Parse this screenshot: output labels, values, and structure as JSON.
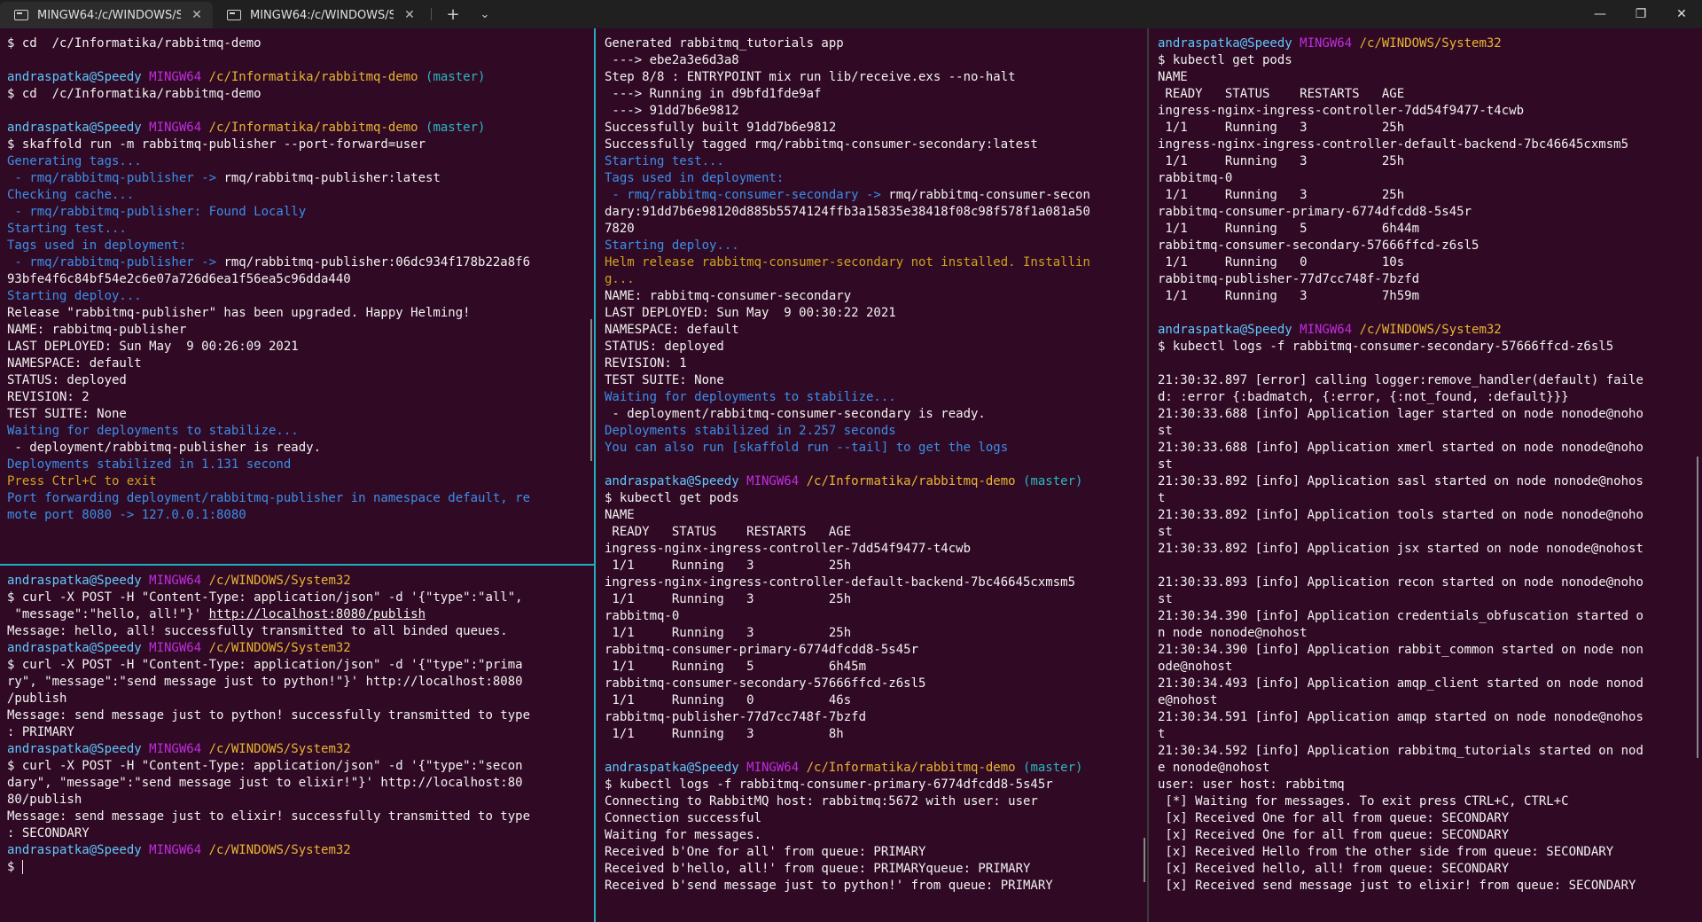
{
  "tabs": [
    {
      "title": "MINGW64:/c/WINDOWS/Syster",
      "close": "✕"
    },
    {
      "title": "MINGW64:/c/WINDOWS/Syster",
      "close": "✕"
    }
  ],
  "toolbar": {
    "new_tab": "+",
    "dropdown": "⌄"
  },
  "window": {
    "minimize": "—",
    "restore": "❐",
    "close": "✕"
  },
  "panes": {
    "top_left": [
      [
        {
          "t": "$ cd  /c/Informatika/rabbitmq-demo",
          "c": "c-white"
        }
      ],
      [],
      [
        {
          "t": "andraspatka@Speedy",
          "c": "prompt-user"
        },
        {
          "t": " MINGW64",
          "c": "prompt-host"
        },
        {
          "t": " /c/Informatika/rabbitmq-demo",
          "c": "prompt-path"
        },
        {
          "t": " (master)",
          "c": "prompt-branch"
        }
      ],
      [
        {
          "t": "$ cd  /c/Informatika/rabbitmq-demo",
          "c": "c-white"
        }
      ],
      [],
      [
        {
          "t": "andraspatka@Speedy",
          "c": "prompt-user"
        },
        {
          "t": " MINGW64",
          "c": "prompt-host"
        },
        {
          "t": " /c/Informatika/rabbitmq-demo",
          "c": "prompt-path"
        },
        {
          "t": " (master)",
          "c": "prompt-branch"
        }
      ],
      [
        {
          "t": "$ skaffold run -m rabbitmq-publisher --port-forward=user",
          "c": "c-white"
        }
      ],
      [
        {
          "t": "Generating tags...",
          "c": "c-blue"
        }
      ],
      [
        {
          "t": " - rmq/rabbitmq-publisher ->",
          "c": "c-blue"
        },
        {
          "t": " rmq/rabbitmq-publisher:latest",
          "c": "c-white"
        }
      ],
      [
        {
          "t": "Checking cache...",
          "c": "c-blue"
        }
      ],
      [
        {
          "t": " - rmq/rabbitmq-publisher: Found Locally",
          "c": "c-blue"
        }
      ],
      [
        {
          "t": "Starting test...",
          "c": "c-blue"
        }
      ],
      [
        {
          "t": "Tags used in deployment:",
          "c": "c-blue"
        }
      ],
      [
        {
          "t": " - rmq/rabbitmq-publisher ->",
          "c": "c-blue"
        },
        {
          "t": " rmq/rabbitmq-publisher:06dc934f178b22a8f6",
          "c": "c-white"
        }
      ],
      [
        {
          "t": "93bfe4f6c84bf54e2c6e07a726d6ea1f56ea5c96dda440",
          "c": "c-white"
        }
      ],
      [
        {
          "t": "Starting deploy...",
          "c": "c-blue"
        }
      ],
      [
        {
          "t": "Release \"rabbitmq-publisher\" has been upgraded. Happy Helming!",
          "c": "c-white"
        }
      ],
      [
        {
          "t": "NAME: rabbitmq-publisher",
          "c": "c-white"
        }
      ],
      [
        {
          "t": "LAST DEPLOYED: Sun May  9 00:26:09 2021",
          "c": "c-white"
        }
      ],
      [
        {
          "t": "NAMESPACE: default",
          "c": "c-white"
        }
      ],
      [
        {
          "t": "STATUS: deployed",
          "c": "c-white"
        }
      ],
      [
        {
          "t": "REVISION: 2",
          "c": "c-white"
        }
      ],
      [
        {
          "t": "TEST SUITE: None",
          "c": "c-white"
        }
      ],
      [
        {
          "t": "Waiting for deployments to stabilize...",
          "c": "c-blue"
        }
      ],
      [
        {
          "t": " - deployment/rabbitmq-publisher is ready.",
          "c": "c-white"
        }
      ],
      [
        {
          "t": "Deployments stabilized in 1.131 second",
          "c": "c-blue"
        }
      ],
      [
        {
          "t": "Press Ctrl+C to exit",
          "c": "c-orange"
        }
      ],
      [
        {
          "t": "Port forwarding deployment/rabbitmq-publisher in namespace default, re",
          "c": "c-blue"
        }
      ],
      [
        {
          "t": "mote port 8080 -> 127.0.0.1:8080",
          "c": "c-blue"
        }
      ]
    ],
    "bottom_left": [
      [
        {
          "t": "andraspatka@Speedy",
          "c": "prompt-user"
        },
        {
          "t": " MINGW64",
          "c": "prompt-host"
        },
        {
          "t": " /c/WINDOWS/System32",
          "c": "prompt-path"
        }
      ],
      [
        {
          "t": "$ curl -X POST -H \"Content-Type: application/json\" -d '{\"type\":\"all\",",
          "c": "c-white"
        }
      ],
      [
        {
          "t": " \"message\":\"hello, all!\"}' ",
          "c": "c-white"
        },
        {
          "t": "http://localhost:8080/publish",
          "c": "c-white c-link"
        }
      ],
      [
        {
          "t": "Message: hello, all! successfully transmitted to all binded queues.",
          "c": "c-white"
        }
      ],
      [
        {
          "t": "andraspatka@Speedy",
          "c": "prompt-user"
        },
        {
          "t": " MINGW64",
          "c": "prompt-host"
        },
        {
          "t": " /c/WINDOWS/System32",
          "c": "prompt-path"
        }
      ],
      [
        {
          "t": "$ curl -X POST -H \"Content-Type: application/json\" -d '{\"type\":\"prima",
          "c": "c-white"
        }
      ],
      [
        {
          "t": "ry\", \"message\":\"send message just to python!\"}' http://localhost:8080",
          "c": "c-white"
        }
      ],
      [
        {
          "t": "/publish",
          "c": "c-white"
        }
      ],
      [
        {
          "t": "Message: send message just to python! successfully transmitted to type",
          "c": "c-white"
        }
      ],
      [
        {
          "t": ": PRIMARY",
          "c": "c-white"
        }
      ],
      [
        {
          "t": "andraspatka@Speedy",
          "c": "prompt-user"
        },
        {
          "t": " MINGW64",
          "c": "prompt-host"
        },
        {
          "t": " /c/WINDOWS/System32",
          "c": "prompt-path"
        }
      ],
      [
        {
          "t": "$ curl -X POST -H \"Content-Type: application/json\" -d '{\"type\":\"secon",
          "c": "c-white"
        }
      ],
      [
        {
          "t": "dary\", \"message\":\"send message just to elixir!\"}' http://localhost:80",
          "c": "c-white"
        }
      ],
      [
        {
          "t": "80/publish",
          "c": "c-white"
        }
      ],
      [
        {
          "t": "Message: send message just to elixir! successfully transmitted to type",
          "c": "c-white"
        }
      ],
      [
        {
          "t": ": SECONDARY",
          "c": "c-white"
        }
      ],
      [
        {
          "t": "andraspatka@Speedy",
          "c": "prompt-user"
        },
        {
          "t": " MINGW64",
          "c": "prompt-host"
        },
        {
          "t": " /c/WINDOWS/System32",
          "c": "prompt-path"
        }
      ],
      [
        {
          "t": "$ ",
          "c": "c-white"
        },
        {
          "cursor": true
        }
      ]
    ],
    "middle": [
      [
        {
          "t": "Generated rabbitmq_tutorials app",
          "c": "c-white"
        }
      ],
      [
        {
          "t": " ---> ebe2a3e6d3a8",
          "c": "c-white"
        }
      ],
      [
        {
          "t": "Step 8/8 : ENTRYPOINT mix run lib/receive.exs --no-halt",
          "c": "c-white"
        }
      ],
      [
        {
          "t": " ---> Running in d9bfd1fde9af",
          "c": "c-white"
        }
      ],
      [
        {
          "t": " ---> 91dd7b6e9812",
          "c": "c-white"
        }
      ],
      [
        {
          "t": "Successfully built 91dd7b6e9812",
          "c": "c-white"
        }
      ],
      [
        {
          "t": "Successfully tagged rmq/rabbitmq-consumer-secondary:latest",
          "c": "c-white"
        }
      ],
      [
        {
          "t": "Starting test...",
          "c": "c-blue"
        }
      ],
      [
        {
          "t": "Tags used in deployment:",
          "c": "c-blue"
        }
      ],
      [
        {
          "t": " - rmq/rabbitmq-consumer-secondary ->",
          "c": "c-blue"
        },
        {
          "t": " rmq/rabbitmq-consumer-secon",
          "c": "c-white"
        }
      ],
      [
        {
          "t": "dary:91dd7b6e98120d885b5574124ffb3a15835e38418f08c98f578f1a081a50",
          "c": "c-white"
        }
      ],
      [
        {
          "t": "7820",
          "c": "c-white"
        }
      ],
      [
        {
          "t": "Starting deploy...",
          "c": "c-blue"
        }
      ],
      [
        {
          "t": "Helm release rabbitmq-consumer-secondary not installed. Installin",
          "c": "c-orange"
        }
      ],
      [
        {
          "t": "g...",
          "c": "c-orange"
        }
      ],
      [
        {
          "t": "NAME: rabbitmq-consumer-secondary",
          "c": "c-white"
        }
      ],
      [
        {
          "t": "LAST DEPLOYED: Sun May  9 00:30:22 2021",
          "c": "c-white"
        }
      ],
      [
        {
          "t": "NAMESPACE: default",
          "c": "c-white"
        }
      ],
      [
        {
          "t": "STATUS: deployed",
          "c": "c-white"
        }
      ],
      [
        {
          "t": "REVISION: 1",
          "c": "c-white"
        }
      ],
      [
        {
          "t": "TEST SUITE: None",
          "c": "c-white"
        }
      ],
      [
        {
          "t": "Waiting for deployments to stabilize...",
          "c": "c-blue"
        }
      ],
      [
        {
          "t": " - deployment/rabbitmq-consumer-secondary is ready.",
          "c": "c-white"
        }
      ],
      [
        {
          "t": "Deployments stabilized in 2.257 seconds",
          "c": "c-blue"
        }
      ],
      [
        {
          "t": "You can also run [skaffold run --tail] to get the logs",
          "c": "c-blue"
        }
      ],
      [],
      [
        {
          "t": "andraspatka@Speedy",
          "c": "prompt-user"
        },
        {
          "t": " MINGW64",
          "c": "prompt-host"
        },
        {
          "t": " /c/Informatika/rabbitmq-demo",
          "c": "prompt-path"
        },
        {
          "t": " (master)",
          "c": "prompt-branch"
        }
      ],
      [
        {
          "t": "$ kubectl get pods",
          "c": "c-white"
        }
      ],
      [
        {
          "t": "NAME",
          "c": "c-white"
        }
      ],
      [
        {
          "t": " READY   STATUS    RESTARTS   AGE",
          "c": "c-white"
        }
      ],
      [
        {
          "t": "ingress-nginx-ingress-controller-7dd54f9477-t4cwb",
          "c": "c-white"
        }
      ],
      [
        {
          "t": " 1/1     Running   3          25h",
          "c": "c-white"
        }
      ],
      [
        {
          "t": "ingress-nginx-ingress-controller-default-backend-7bc46645cxmsm5",
          "c": "c-white"
        }
      ],
      [
        {
          "t": " 1/1     Running   3          25h",
          "c": "c-white"
        }
      ],
      [
        {
          "t": "rabbitmq-0",
          "c": "c-white"
        }
      ],
      [
        {
          "t": " 1/1     Running   3          25h",
          "c": "c-white"
        }
      ],
      [
        {
          "t": "rabbitmq-consumer-primary-6774dfcdd8-5s45r",
          "c": "c-white"
        }
      ],
      [
        {
          "t": " 1/1     Running   5          6h45m",
          "c": "c-white"
        }
      ],
      [
        {
          "t": "rabbitmq-consumer-secondary-57666ffcd-z6sl5",
          "c": "c-white"
        }
      ],
      [
        {
          "t": " 1/1     Running   0          46s",
          "c": "c-white"
        }
      ],
      [
        {
          "t": "rabbitmq-publisher-77d7cc748f-7bzfd",
          "c": "c-white"
        }
      ],
      [
        {
          "t": " 1/1     Running   3          8h",
          "c": "c-white"
        }
      ],
      [],
      [
        {
          "t": "andraspatka@Speedy",
          "c": "prompt-user"
        },
        {
          "t": " MINGW64",
          "c": "prompt-host"
        },
        {
          "t": " /c/Informatika/rabbitmq-demo",
          "c": "prompt-path"
        },
        {
          "t": " (master)",
          "c": "prompt-branch"
        }
      ],
      [
        {
          "t": "$ kubectl logs -f rabbitmq-consumer-primary-6774dfcdd8-5s45r",
          "c": "c-white"
        }
      ],
      [
        {
          "t": "Connecting to RabbitMQ host: rabbitmq:5672 with user: user",
          "c": "c-white"
        }
      ],
      [
        {
          "t": "Connection successful",
          "c": "c-white"
        }
      ],
      [
        {
          "t": "Waiting for messages.",
          "c": "c-white"
        }
      ],
      [
        {
          "t": "Received b'One for all' from queue: PRIMARY",
          "c": "c-white"
        }
      ],
      [
        {
          "t": "Received b'hello, all!' from queue: PRIMARYqueue: PRIMARY",
          "c": "c-white"
        }
      ],
      [
        {
          "t": "Received b'send message just to python!' from queue: PRIMARY",
          "c": "c-white"
        }
      ]
    ],
    "right": [
      [
        {
          "t": "andraspatka@Speedy",
          "c": "prompt-user"
        },
        {
          "t": " MINGW64",
          "c": "prompt-host"
        },
        {
          "t": " /c/WINDOWS/System32",
          "c": "prompt-path"
        }
      ],
      [
        {
          "t": "$ kubectl get pods",
          "c": "c-white"
        }
      ],
      [
        {
          "t": "NAME",
          "c": "c-white"
        }
      ],
      [
        {
          "t": " READY   STATUS    RESTARTS   AGE",
          "c": "c-white"
        }
      ],
      [
        {
          "t": "ingress-nginx-ingress-controller-7dd54f9477-t4cwb",
          "c": "c-white"
        }
      ],
      [
        {
          "t": " 1/1     Running   3          25h",
          "c": "c-white"
        }
      ],
      [
        {
          "t": "ingress-nginx-ingress-controller-default-backend-7bc46645cxmsm5",
          "c": "c-white"
        }
      ],
      [
        {
          "t": " 1/1     Running   3          25h",
          "c": "c-white"
        }
      ],
      [
        {
          "t": "rabbitmq-0",
          "c": "c-white"
        }
      ],
      [
        {
          "t": " 1/1     Running   3          25h",
          "c": "c-white"
        }
      ],
      [
        {
          "t": "rabbitmq-consumer-primary-6774dfcdd8-5s45r",
          "c": "c-white"
        }
      ],
      [
        {
          "t": " 1/1     Running   5          6h44m",
          "c": "c-white"
        }
      ],
      [
        {
          "t": "rabbitmq-consumer-secondary-57666ffcd-z6sl5",
          "c": "c-white"
        }
      ],
      [
        {
          "t": " 1/1     Running   0          10s",
          "c": "c-white"
        }
      ],
      [
        {
          "t": "rabbitmq-publisher-77d7cc748f-7bzfd",
          "c": "c-white"
        }
      ],
      [
        {
          "t": " 1/1     Running   3          7h59m",
          "c": "c-white"
        }
      ],
      [],
      [
        {
          "t": "andraspatka@Speedy",
          "c": "prompt-user"
        },
        {
          "t": " MINGW64",
          "c": "prompt-host"
        },
        {
          "t": " /c/WINDOWS/System32",
          "c": "prompt-path"
        }
      ],
      [
        {
          "t": "$ kubectl logs -f rabbitmq-consumer-secondary-57666ffcd-z6sl5",
          "c": "c-white"
        }
      ],
      [],
      [
        {
          "t": "21:30:32.897 [error] calling logger:remove_handler(default) faile",
          "c": "c-white"
        }
      ],
      [
        {
          "t": "d: :error {:badmatch, {:error, {:not_found, :default}}}",
          "c": "c-white"
        }
      ],
      [
        {
          "t": "21:30:33.688 [info] Application lager started on node nonode@noho",
          "c": "c-white"
        }
      ],
      [
        {
          "t": "st",
          "c": "c-white"
        }
      ],
      [
        {
          "t": "21:30:33.688 [info] Application xmerl started on node nonode@noho",
          "c": "c-white"
        }
      ],
      [
        {
          "t": "st",
          "c": "c-white"
        }
      ],
      [
        {
          "t": "21:30:33.892 [info] Application sasl started on node nonode@nohos",
          "c": "c-white"
        }
      ],
      [
        {
          "t": "t",
          "c": "c-white"
        }
      ],
      [
        {
          "t": "21:30:33.892 [info] Application tools started on node nonode@noho",
          "c": "c-white"
        }
      ],
      [
        {
          "t": "st",
          "c": "c-white"
        }
      ],
      [
        {
          "t": "21:30:33.892 [info] Application jsx started on node nonode@nohost",
          "c": "c-white"
        }
      ],
      [],
      [
        {
          "t": "21:30:33.893 [info] Application recon started on node nonode@noho",
          "c": "c-white"
        }
      ],
      [
        {
          "t": "st",
          "c": "c-white"
        }
      ],
      [
        {
          "t": "21:30:34.390 [info] Application credentials_obfuscation started o",
          "c": "c-white"
        }
      ],
      [
        {
          "t": "n node nonode@nohost",
          "c": "c-white"
        }
      ],
      [
        {
          "t": "21:30:34.390 [info] Application rabbit_common started on node non",
          "c": "c-white"
        }
      ],
      [
        {
          "t": "ode@nohost",
          "c": "c-white"
        }
      ],
      [
        {
          "t": "21:30:34.493 [info] Application amqp_client started on node nonod",
          "c": "c-white"
        }
      ],
      [
        {
          "t": "e@nohost",
          "c": "c-white"
        }
      ],
      [
        {
          "t": "21:30:34.591 [info] Application amqp started on node nonode@nohos",
          "c": "c-white"
        }
      ],
      [
        {
          "t": "t",
          "c": "c-white"
        }
      ],
      [
        {
          "t": "21:30:34.592 [info] Application rabbitmq_tutorials started on nod",
          "c": "c-white"
        }
      ],
      [
        {
          "t": "e nonode@nohost",
          "c": "c-white"
        }
      ],
      [
        {
          "t": "user: user host: rabbitmq",
          "c": "c-white"
        }
      ],
      [
        {
          "t": " [*] Waiting for messages. To exit press CTRL+C, CTRL+C",
          "c": "c-white"
        }
      ],
      [
        {
          "t": " [x] Received One for all from queue: SECONDARY",
          "c": "c-white"
        }
      ],
      [
        {
          "t": " [x] Received One for all from queue: SECONDARY",
          "c": "c-white"
        }
      ],
      [
        {
          "t": " [x] Received Hello from the other side from queue: SECONDARY",
          "c": "c-white"
        }
      ],
      [
        {
          "t": " [x] Received hello, all! from queue: SECONDARY",
          "c": "c-white"
        }
      ],
      [
        {
          "t": " [x] Received send message just to elixir! from queue: SECONDARY",
          "c": "c-white"
        }
      ]
    ]
  }
}
